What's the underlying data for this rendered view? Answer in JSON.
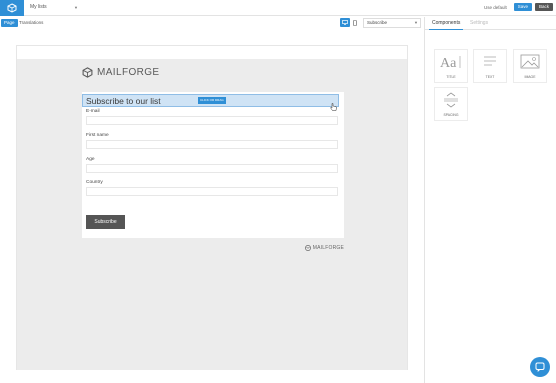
{
  "topbar": {
    "list_name": "My lists",
    "use_default": "Use default",
    "save_label": "Save",
    "back_label": "Back"
  },
  "subbar": {
    "tab_page": "Page",
    "tab_translations": "Translations",
    "form_select": "Subscribe"
  },
  "canvas": {
    "brand": "MAILFORGE",
    "form_title": "Subscribe to our list",
    "click_chip": "CLICK OR DRAG",
    "fields": [
      {
        "label": "E-mail"
      },
      {
        "label": "First name"
      },
      {
        "label": "Age"
      },
      {
        "label": "Country"
      }
    ],
    "submit_label": "Subscribe",
    "footer_brand": "MAILFORGE"
  },
  "panel": {
    "tab_components": "Components",
    "tab_settings": "Settings",
    "components": [
      {
        "label": "TITLE",
        "icon": "title-icon"
      },
      {
        "label": "TEXT",
        "icon": "text-icon"
      },
      {
        "label": "IMAGE",
        "icon": "image-icon"
      },
      {
        "label": "SPACING",
        "icon": "spacing-icon"
      }
    ]
  },
  "colors": {
    "accent": "#2f8fd6",
    "dark_button": "#555555",
    "canvas_bg": "#ececec",
    "selection_bg": "#cfe3f5"
  }
}
